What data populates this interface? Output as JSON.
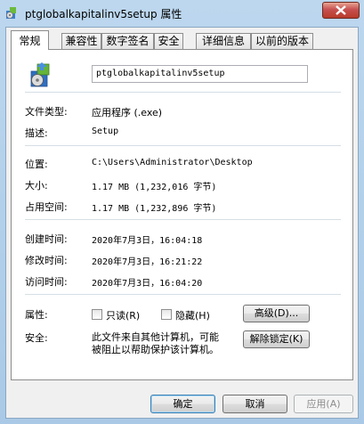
{
  "window": {
    "title": "ptglobalkapitalinv5setup 属性"
  },
  "tabs": [
    "常规",
    "兼容性",
    "数字签名",
    "安全",
    "详细信息",
    "以前的版本"
  ],
  "general": {
    "file_name": "ptglobalkapitalinv5setup",
    "type_label": "文件类型:",
    "type_value": "应用程序 (.exe)",
    "desc_label": "描述:",
    "desc_value": "Setup",
    "location_label": "位置:",
    "location_value": "C:\\Users\\Administrator\\Desktop",
    "size_label": "大小:",
    "size_value": "1.17 MB (1,232,016 字节)",
    "disk_label": "占用空间:",
    "disk_value": "1.17 MB (1,232,896 字节)",
    "created_label": "创建时间:",
    "created_value": "2020年7月3日，16:04:18",
    "modified_label": "修改时间:",
    "modified_value": "2020年7月3日，16:21:22",
    "accessed_label": "访问时间:",
    "accessed_value": "2020年7月3日，16:04:20",
    "attr_label": "属性:",
    "readonly_label": "只读(R)",
    "hidden_label": "隐藏(H)",
    "advanced_label": "高级(D)...",
    "security_label": "安全:",
    "security_line1": "此文件来自其他计算机，可能",
    "security_line2": "被阻止以帮助保护该计算机。",
    "unblock_label": "解除锁定(K)"
  },
  "footer": {
    "ok": "确定",
    "cancel": "取消",
    "apply": "应用(A)"
  }
}
